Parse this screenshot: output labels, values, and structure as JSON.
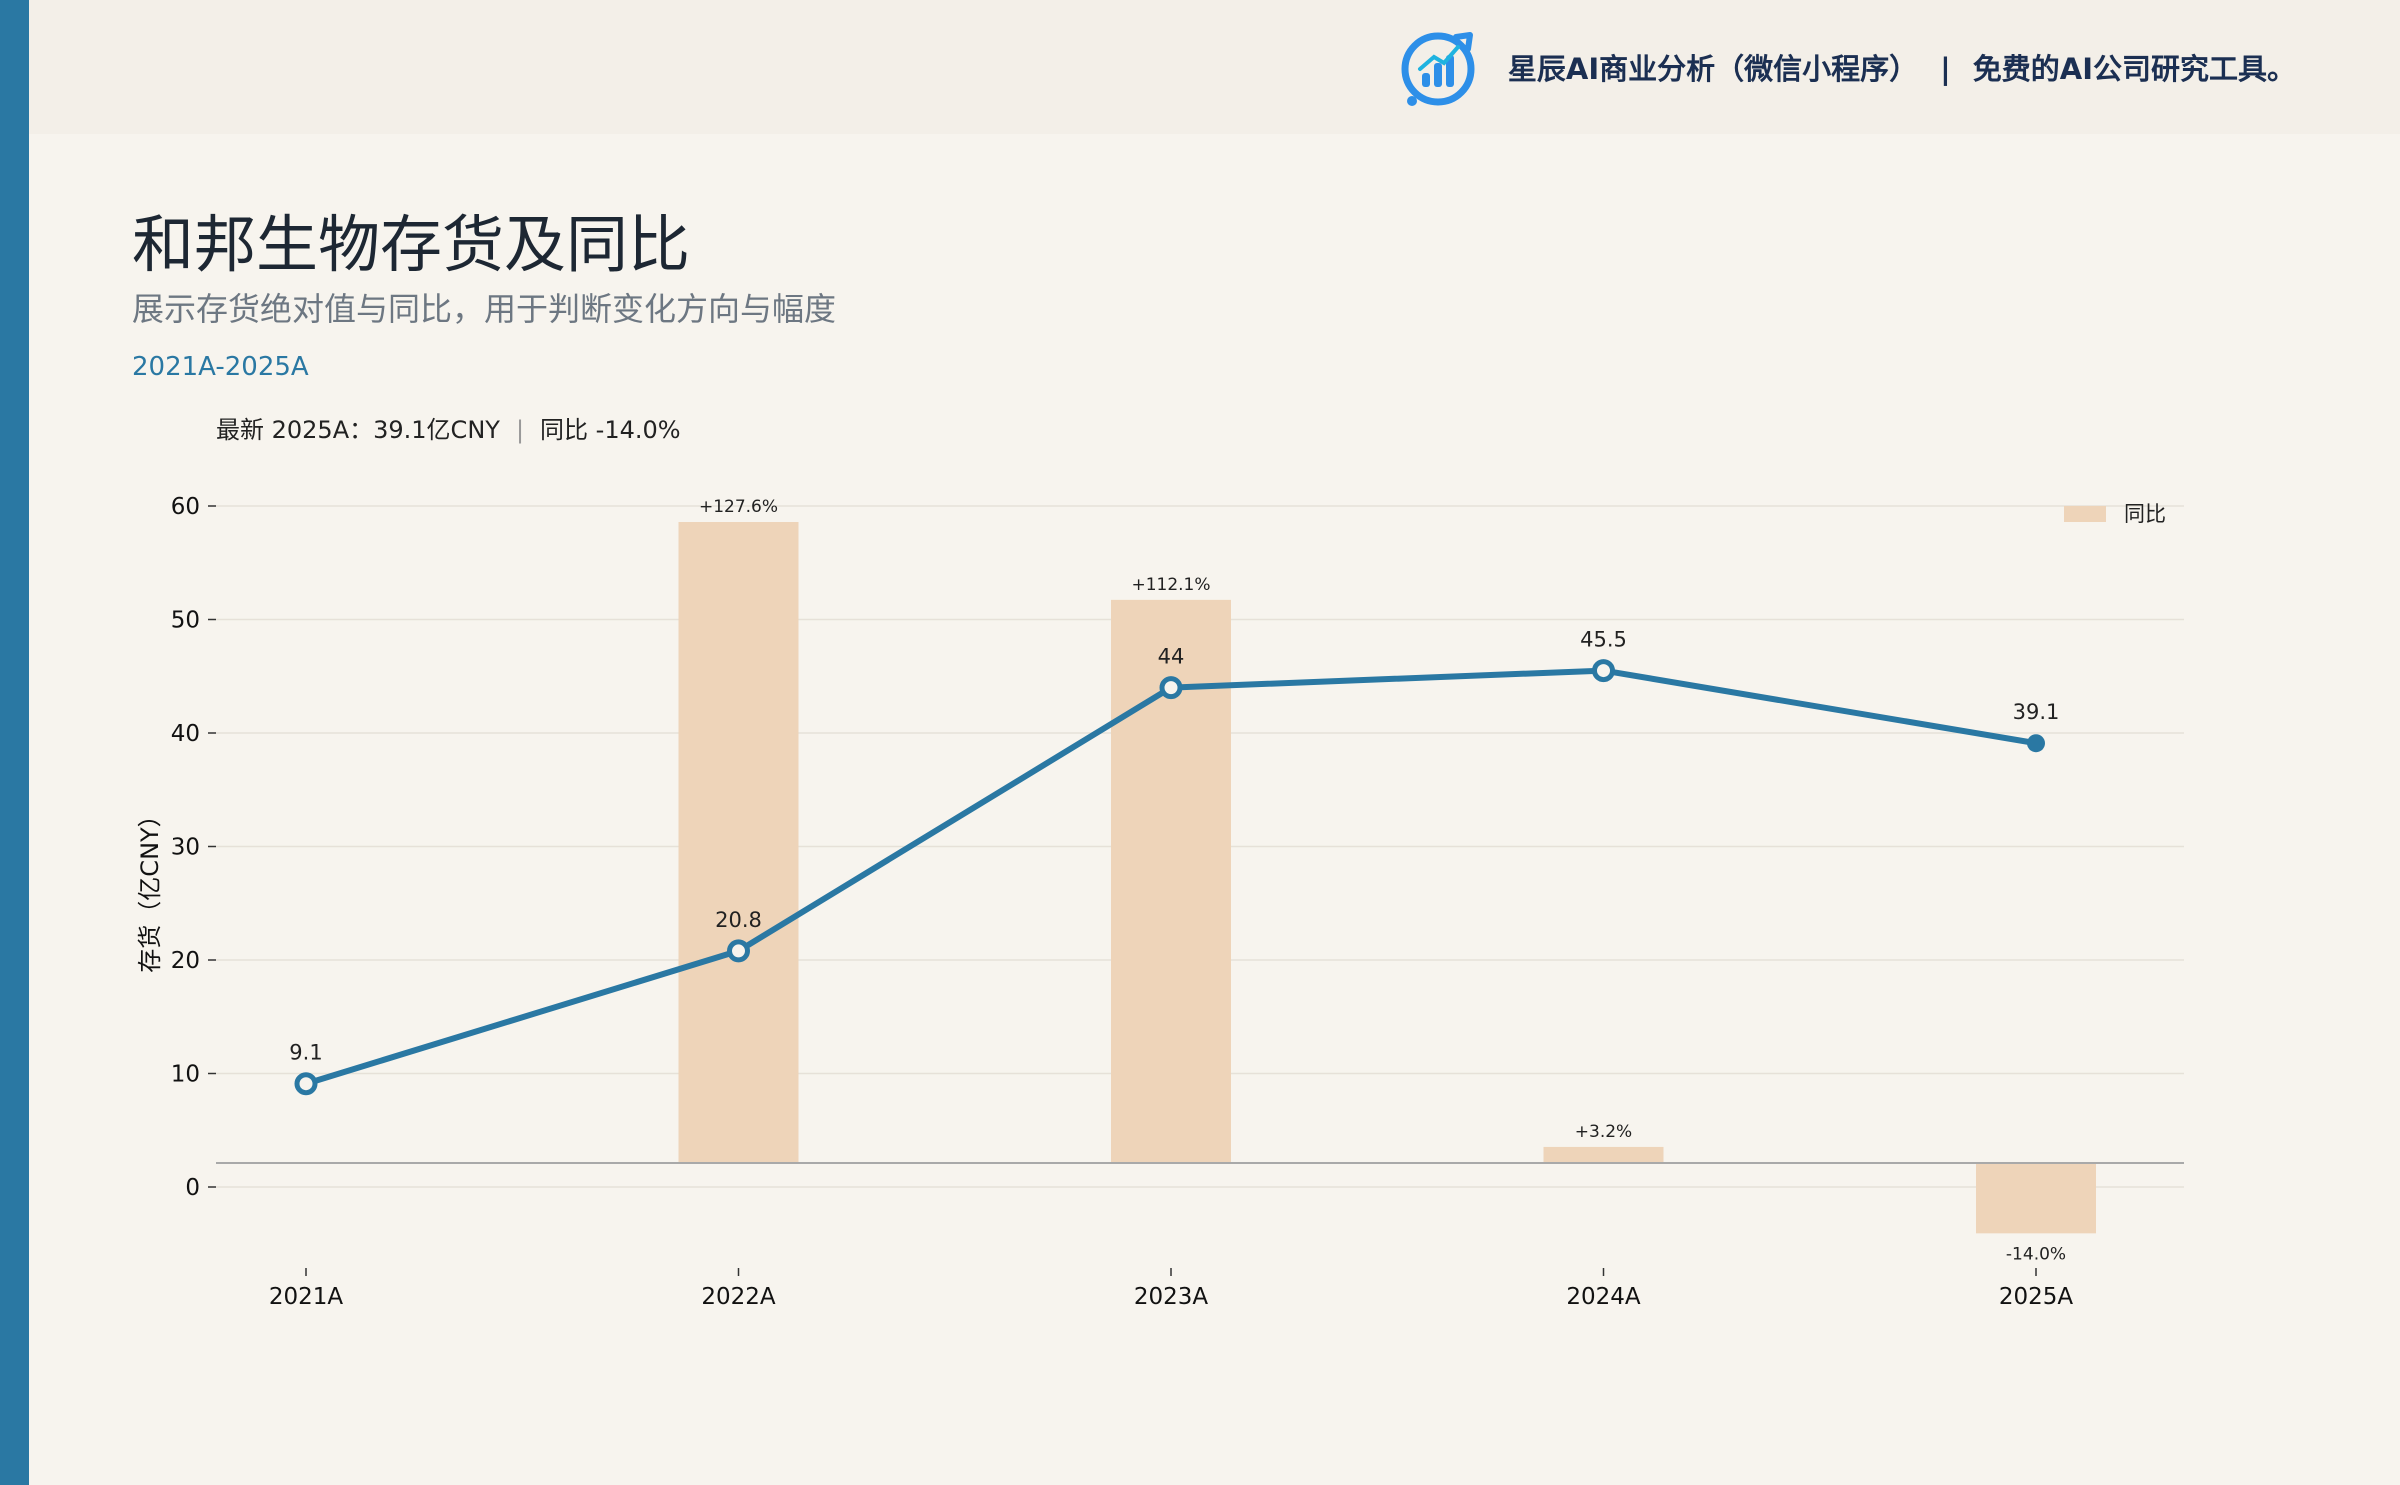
{
  "header": {
    "brand_name": "星辰AI商业分析（微信小程序）",
    "brand_separator": "|",
    "brand_tagline": "免费的AI公司研究工具。"
  },
  "title": "和邦生物存货及同比",
  "subtitle": "展示存货绝对值与同比，用于判断变化方向与幅度",
  "period": "2021A-2025A",
  "latest": {
    "text": "最新 2025A：39.1亿CNY",
    "separator": "|",
    "yoy_text": "同比 -14.0%"
  },
  "colors": {
    "accent": "#2a78a3",
    "bar": "#eed4b9",
    "line": "#2a78a3",
    "background": "#f7f4ee"
  },
  "chart_data": {
    "type": "bar+line",
    "categories": [
      "2021A",
      "2022A",
      "2023A",
      "2024A",
      "2025A"
    ],
    "ylabel": "存货（亿CNY）",
    "ylim": [
      -6,
      62
    ],
    "yticks": [
      0,
      10,
      20,
      30,
      40,
      50,
      60
    ],
    "grid": true,
    "legend_position": "top-right",
    "series": [
      {
        "name": "存货",
        "kind": "line",
        "values": [
          9.1,
          20.8,
          44.0,
          45.5,
          39.1
        ],
        "labels": [
          "9.1",
          "20.8",
          "44",
          "45.5",
          "39.1"
        ]
      },
      {
        "name": "同比",
        "kind": "bar",
        "values": [
          null,
          127.6,
          112.1,
          3.2,
          -14.0
        ],
        "labels": [
          "",
          "+127.6%",
          "+112.1%",
          "+3.2%",
          "-14.0%"
        ]
      }
    ]
  }
}
